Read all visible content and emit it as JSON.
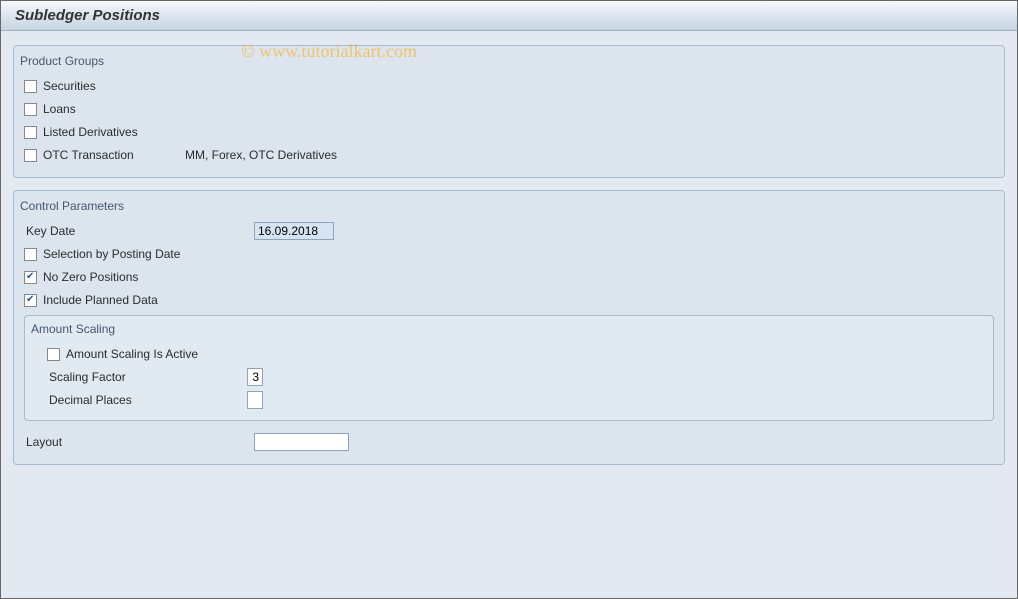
{
  "header": {
    "title": "Subledger Positions"
  },
  "watermark": "© www.tutorialkart.com",
  "product_groups": {
    "title": "Product Groups",
    "items": {
      "securities": {
        "label": "Securities"
      },
      "loans": {
        "label": "Loans"
      },
      "listed_derivatives": {
        "label": "Listed Derivatives"
      },
      "otc_transaction": {
        "label": "OTC Transaction",
        "extra": "MM, Forex, OTC Derivatives"
      }
    }
  },
  "control_parameters": {
    "title": "Control Parameters",
    "key_date": {
      "label": "Key Date",
      "value": "16.09.2018"
    },
    "selection_posting": {
      "label": "Selection by Posting Date"
    },
    "no_zero": {
      "label": "No Zero Positions"
    },
    "include_planned": {
      "label": "Include Planned Data"
    },
    "amount_scaling": {
      "title": "Amount Scaling",
      "active": {
        "label": "Amount Scaling Is Active"
      },
      "scaling_factor": {
        "label": "Scaling Factor",
        "value": "3"
      },
      "decimal_places": {
        "label": "Decimal Places",
        "value": ""
      }
    },
    "layout": {
      "label": "Layout",
      "value": ""
    }
  }
}
